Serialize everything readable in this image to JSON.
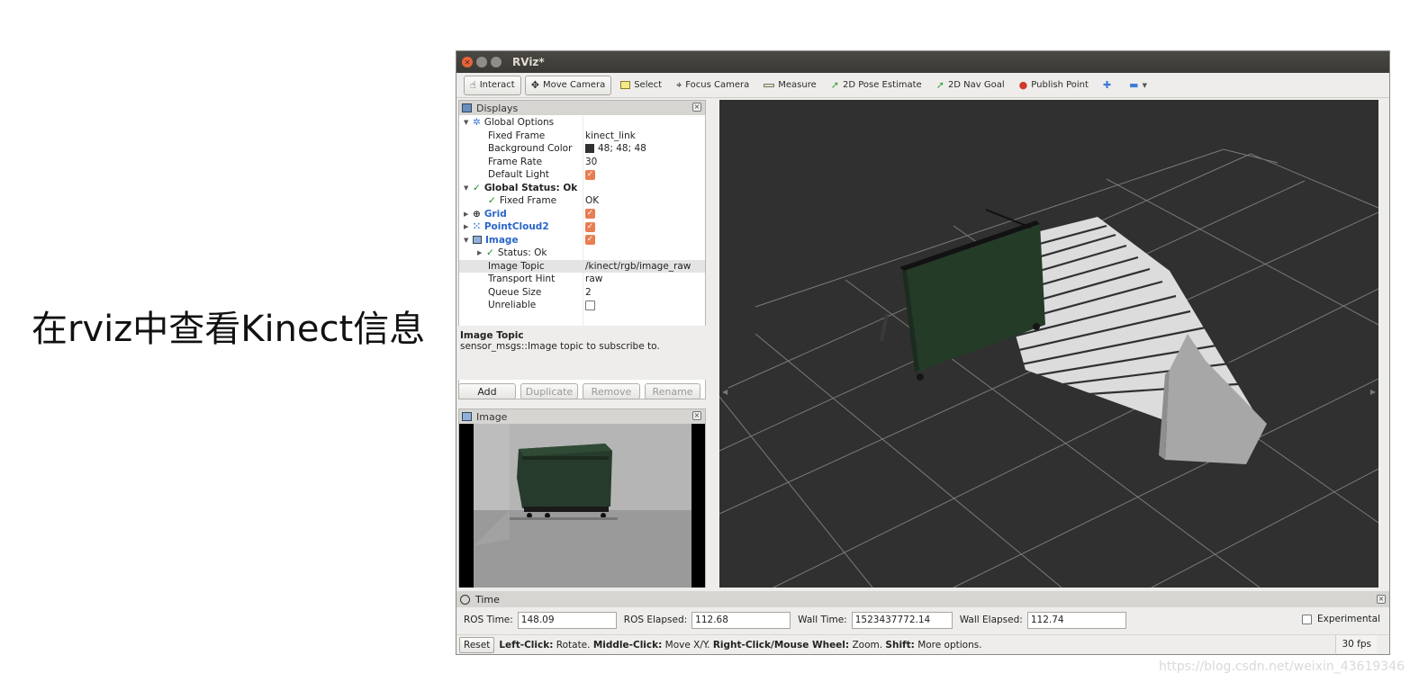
{
  "slide": {
    "title": "在rviz中查看Kinect信息",
    "watermark": "https://blog.csdn.net/weixin_43619346"
  },
  "window": {
    "title": "RViz*"
  },
  "toolbar": {
    "tools": [
      {
        "label": "Interact",
        "icon": "hand-icon",
        "active": true
      },
      {
        "label": "Move Camera",
        "icon": "move-camera-icon",
        "active": true
      },
      {
        "label": "Select",
        "icon": "select-icon",
        "active": false
      },
      {
        "label": "Focus Camera",
        "icon": "focus-camera-icon",
        "active": false
      },
      {
        "label": "Measure",
        "icon": "measure-icon",
        "active": false
      },
      {
        "label": "2D Pose Estimate",
        "icon": "pose-arrow-icon",
        "active": false
      },
      {
        "label": "2D Nav Goal",
        "icon": "nav-goal-icon",
        "active": false
      },
      {
        "label": "Publish Point",
        "icon": "map-pin-icon",
        "active": false
      }
    ]
  },
  "displays": {
    "header": "Displays",
    "rows": [
      {
        "label": "Global Options",
        "value": ""
      },
      {
        "label": "Fixed Frame",
        "value": "kinect_link"
      },
      {
        "label": "Background Color",
        "value": "48; 48; 48"
      },
      {
        "label": "Frame Rate",
        "value": "30"
      },
      {
        "label": "Default Light",
        "value": ""
      },
      {
        "label": "Global Status: Ok",
        "value": ""
      },
      {
        "label": "Fixed Frame",
        "value": "OK"
      },
      {
        "label": "Grid",
        "value": ""
      },
      {
        "label": "PointCloud2",
        "value": ""
      },
      {
        "label": "Image",
        "value": ""
      },
      {
        "label": "Status: Ok",
        "value": ""
      },
      {
        "label": "Image Topic",
        "value": "/kinect/rgb/image_raw"
      },
      {
        "label": "Transport Hint",
        "value": "raw"
      },
      {
        "label": "Queue Size",
        "value": "2"
      },
      {
        "label": "Unreliable",
        "value": ""
      }
    ],
    "description_title": "Image Topic",
    "description_text": "sensor_msgs::Image topic to subscribe to.",
    "buttons": {
      "add": "Add",
      "duplicate": "Duplicate",
      "remove": "Remove",
      "rename": "Rename"
    }
  },
  "image_panel": {
    "header": "Image"
  },
  "time_panel": {
    "header": "Time",
    "ros_time_label": "ROS Time:",
    "ros_time": "148.09",
    "ros_elapsed_label": "ROS Elapsed:",
    "ros_elapsed": "112.68",
    "wall_time_label": "Wall Time:",
    "wall_time": "1523437772.14",
    "wall_elapsed_label": "Wall Elapsed:",
    "wall_elapsed": "112.74",
    "experimental_label": "Experimental"
  },
  "status_bar": {
    "reset": "Reset",
    "hint_left_click": "Left-Click:",
    "hint_rotate": "Rotate.",
    "hint_middle_click": "Middle-Click:",
    "hint_move": "Move X/Y.",
    "hint_right_click": "Right-Click/Mouse Wheel:",
    "hint_zoom": "Zoom.",
    "hint_shift": "Shift:",
    "hint_more": "More options.",
    "fps": "30 fps"
  },
  "colors": {
    "viewport_bg": "#303030",
    "grid_line": "#7a7a7a",
    "accent_checkbox": "#e87e52",
    "display_blue": "#2a66c9"
  }
}
